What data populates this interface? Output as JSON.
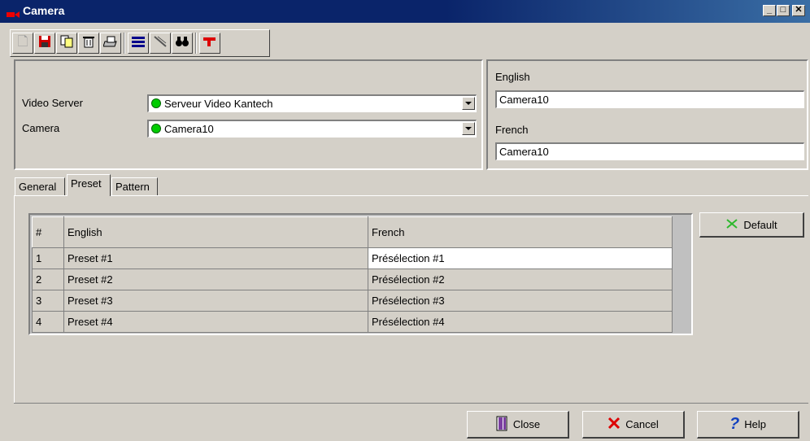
{
  "window": {
    "title": "Camera"
  },
  "toolbar": {
    "icons": [
      "new-icon",
      "save-icon",
      "copy-icon",
      "delete-icon",
      "print-icon",
      "list-icon",
      "link-icon",
      "find-icon",
      "pointer-icon"
    ]
  },
  "header": {
    "video_server_label": "Video Server",
    "video_server_value": "Serveur Video Kantech",
    "camera_label": "Camera",
    "camera_value": "Camera10",
    "english_label": "English",
    "english_value": "Camera10",
    "french_label": "French",
    "french_value": "Camera10"
  },
  "tabs": [
    {
      "label": "General"
    },
    {
      "label": "Preset"
    },
    {
      "label": "Pattern"
    }
  ],
  "grid": {
    "columns": [
      "#",
      "English",
      "French"
    ],
    "rows": [
      [
        "1",
        "Preset #1",
        "Présélection #1"
      ],
      [
        "2",
        "Preset #2",
        "Présélection #2"
      ],
      [
        "3",
        "Preset #3",
        "Présélection #3"
      ],
      [
        "4",
        "Preset #4",
        "Présélection #4"
      ]
    ]
  },
  "buttons": {
    "default_label": "Default",
    "close_label": "Close",
    "cancel_label": "Cancel",
    "help_label": "Help"
  },
  "colors": {
    "title_bar": "#0a246a",
    "status_ok": "#00cc00",
    "face": "#d4d0c8"
  }
}
